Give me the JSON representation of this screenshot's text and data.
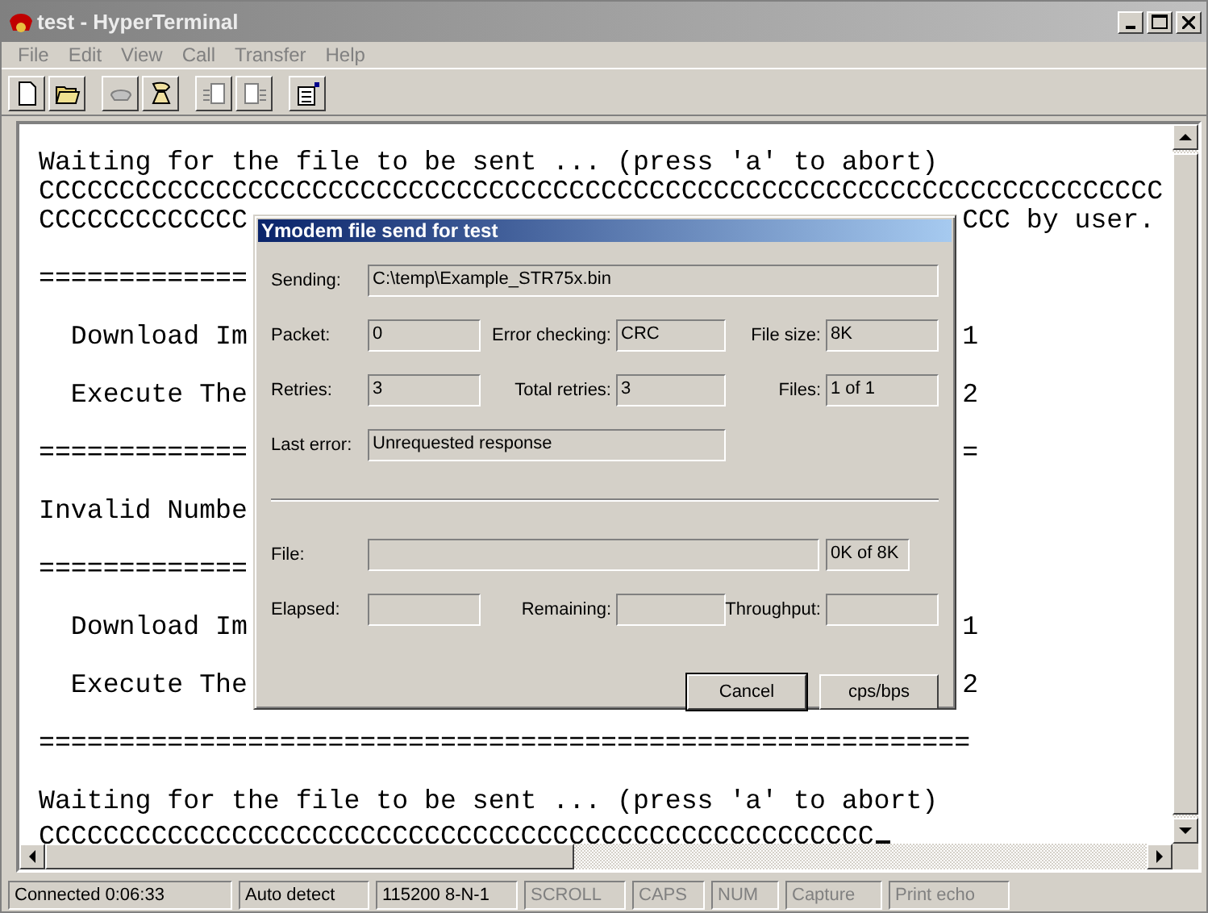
{
  "window": {
    "title": "test - HyperTerminal"
  },
  "menu": [
    "File",
    "Edit",
    "View",
    "Call",
    "Transfer",
    "Help"
  ],
  "toolbar": [
    {
      "kind": "new",
      "disabled": false
    },
    {
      "kind": "open",
      "disabled": false
    },
    {
      "kind": "call",
      "disabled": true
    },
    {
      "kind": "hangup",
      "disabled": false
    },
    {
      "kind": "send",
      "disabled": true
    },
    {
      "kind": "receive",
      "disabled": true
    },
    {
      "kind": "properties",
      "disabled": false
    }
  ],
  "terminal": {
    "lines": [
      {
        "kind": "text",
        "text": "Waiting for the file to be sent ... (press 'a' to abort)"
      },
      {
        "kind": "text",
        "text": "CCCCCCCCCCCCCCCCCCCCCCCCCCCCCCCCCCCCCCCCCCCCCCCCCCCCCCCCCCCCCCCCCCCCCC"
      },
      {
        "kind": "text",
        "text": "CCCCCCCCCCCCC",
        "after_dialog": "CCC by user."
      },
      {
        "kind": "blank"
      },
      {
        "kind": "text",
        "text": "============="
      },
      {
        "kind": "blank"
      },
      {
        "kind": "text",
        "text": "  Download Im",
        "after_dialog": "1"
      },
      {
        "kind": "blank"
      },
      {
        "kind": "text",
        "text": "  Execute The",
        "after_dialog": "2"
      },
      {
        "kind": "blank"
      },
      {
        "kind": "text",
        "text": "=============",
        "after_dialog": "="
      },
      {
        "kind": "blank"
      },
      {
        "kind": "text",
        "text": "Invalid Numbe"
      },
      {
        "kind": "blank"
      },
      {
        "kind": "text",
        "text": "============="
      },
      {
        "kind": "blank"
      },
      {
        "kind": "text",
        "text": "  Download Im",
        "after_dialog": "1"
      },
      {
        "kind": "blank"
      },
      {
        "kind": "text",
        "text": "  Execute The",
        "after_dialog": "2"
      },
      {
        "kind": "blank"
      },
      {
        "kind": "text",
        "text": "=========================================================="
      },
      {
        "kind": "blank"
      },
      {
        "kind": "text",
        "text": "Waiting for the file to be sent ... (press 'a' to abort)"
      },
      {
        "kind": "text",
        "text": "CCCCCCCCCCCCCCCCCCCCCCCCCCCCCCCCCCCCCCCCCCCCCCCCCCCC",
        "cursor": true
      }
    ]
  },
  "dialog": {
    "title": "Ymodem file send for test",
    "sending": {
      "label": "Sending:",
      "value": "C:\\temp\\Example_STR75x.bin"
    },
    "stats": [
      [
        {
          "label": "Packet:",
          "value": "0"
        },
        {
          "label": "Error checking:",
          "value": "CRC"
        },
        {
          "label": "File size:",
          "value": "8K"
        }
      ],
      [
        {
          "label": "Retries:",
          "value": "3"
        },
        {
          "label": "Total retries:",
          "value": "3"
        },
        {
          "label": "Files:",
          "value": "1 of 1"
        }
      ]
    ],
    "last_error": {
      "label": "Last error:",
      "value": "Unrequested response"
    },
    "file": {
      "label": "File:",
      "level": 0,
      "value": "0K of 8K"
    },
    "timing": [
      {
        "label": "Elapsed:"
      },
      {
        "label": "Remaining:"
      },
      {
        "label": "Throughput:"
      }
    ],
    "buttons": [
      {
        "label": "Cancel",
        "default": true
      },
      {
        "label": "cps/bps",
        "default": false
      }
    ]
  },
  "status_bar": [
    {
      "text": "Connected 0:06:33",
      "disabled": false
    },
    {
      "text": "Auto detect",
      "disabled": false
    },
    {
      "text": "115200 8-N-1",
      "disabled": false
    },
    {
      "text": "SCROLL",
      "disabled": true
    },
    {
      "text": "CAPS",
      "disabled": true
    },
    {
      "text": "NUM",
      "disabled": true
    },
    {
      "text": "Capture",
      "disabled": true
    },
    {
      "text": "Print echo",
      "disabled": true
    }
  ]
}
